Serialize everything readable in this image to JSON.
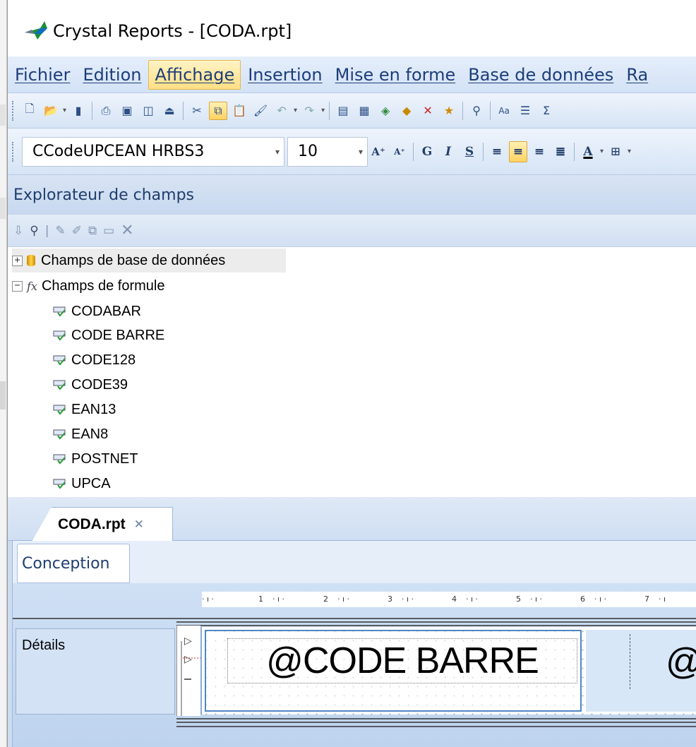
{
  "window": {
    "title": "Crystal Reports - [CODA.rpt]"
  },
  "menubar": [
    {
      "label": "Fichier",
      "active": false
    },
    {
      "label": "Edition",
      "active": false
    },
    {
      "label": "Affichage",
      "active": true
    },
    {
      "label": "Insertion",
      "active": false
    },
    {
      "label": "Mise en forme",
      "active": false
    },
    {
      "label": "Base de données",
      "active": false
    },
    {
      "label": "Ra",
      "active": false
    }
  ],
  "format_toolbar": {
    "font": "CCodeUPCEAN HRBS3",
    "size": "10",
    "bold": "G",
    "italic": "I",
    "underline": "S",
    "font_color": "A"
  },
  "field_explorer": {
    "title": "Explorateur de champs",
    "tree": {
      "database_fields": "Champs de base de données",
      "formula_fields": "Champs de formule",
      "formulas": [
        "CODABAR",
        "CODE BARRE",
        "CODE128",
        "CODE39",
        "EAN13",
        "EAN8",
        "POSTNET",
        "UPCA"
      ]
    }
  },
  "document": {
    "tab": "CODA.rpt",
    "view_tab": "Conception",
    "ruler_numbers": [
      "1",
      "2",
      "3",
      "4",
      "5",
      "6",
      "7"
    ],
    "section": "Détails",
    "field_main": "@CODE BARRE",
    "field_partial": "@"
  }
}
